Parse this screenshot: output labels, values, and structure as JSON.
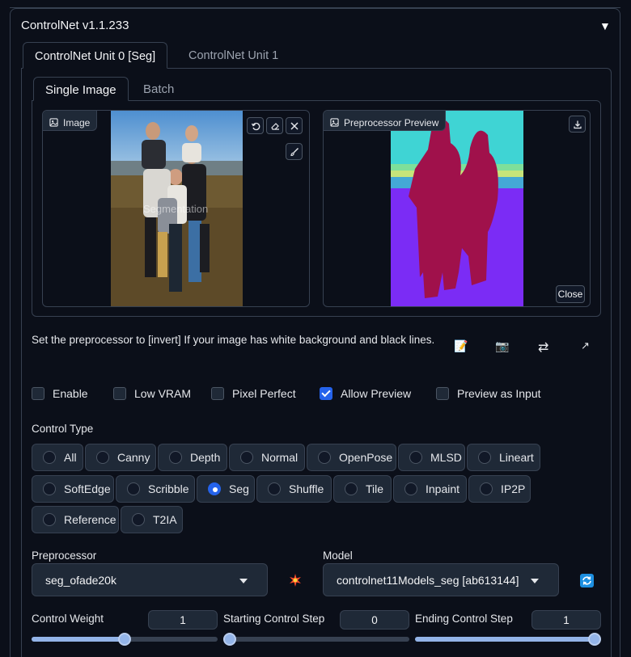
{
  "accordion": {
    "title": "ControlNet v1.1.233",
    "caret": "▼"
  },
  "unit_tabs": [
    "ControlNet Unit 0 [Seg]",
    "ControlNet Unit 1"
  ],
  "image_tabs": [
    "Single Image",
    "Batch"
  ],
  "image_panel": {
    "label": "Image",
    "overlay_text": "Segmentation"
  },
  "preview_panel": {
    "label": "Preprocessor Preview",
    "close_label": "Close"
  },
  "hint": "Set the preprocessor to [invert] If your image has white background and black lines.",
  "tool_icons": [
    "📝",
    "📷",
    "⇄",
    "↗"
  ],
  "checkboxes": [
    {
      "label": "Enable",
      "checked": false
    },
    {
      "label": "Low VRAM",
      "checked": false
    },
    {
      "label": "Pixel Perfect",
      "checked": false
    },
    {
      "label": "Allow Preview",
      "checked": true
    },
    {
      "label": "Preview as Input",
      "checked": false
    }
  ],
  "control_type": {
    "label": "Control Type",
    "options": [
      "All",
      "Canny",
      "Depth",
      "Normal",
      "OpenPose",
      "MLSD",
      "Lineart",
      "SoftEdge",
      "Scribble",
      "Seg",
      "Shuffle",
      "Tile",
      "Inpaint",
      "IP2P",
      "Reference",
      "T2IA"
    ],
    "selected": "Seg"
  },
  "preprocessor": {
    "label": "Preprocessor",
    "value": "seg_ofade20k"
  },
  "model": {
    "label": "Model",
    "value": "controlnet11Models_seg [ab613144]"
  },
  "sliders": [
    {
      "label": "Control Weight",
      "value": "1",
      "fraction": 0.5
    },
    {
      "label": "Starting Control Step",
      "value": "0",
      "fraction": 0.0
    },
    {
      "label": "Ending Control Step",
      "value": "1",
      "fraction": 1.0
    }
  ],
  "colors": {
    "accent": "#2563eb",
    "slider": "#93b4e8",
    "background": "#0b0f19",
    "seg_person": "#a0114b",
    "seg_sky": "#3fd4d4",
    "seg_ground": "#7b2cf5"
  }
}
